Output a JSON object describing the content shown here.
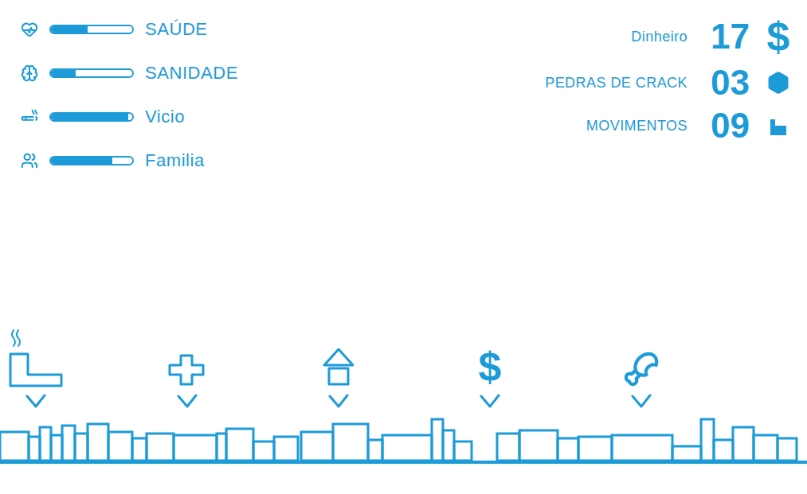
{
  "stats": [
    {
      "label": "SAÚDE",
      "kind": "health",
      "level": 0.45
    },
    {
      "label": "SANIDADE",
      "kind": "sanity",
      "level": 0.3
    },
    {
      "label": "Vicio",
      "kind": "addiction",
      "level": 0.95
    },
    {
      "label": "Familia",
      "kind": "family",
      "level": 0.75
    }
  ],
  "resources": [
    {
      "label": "Dinheiro",
      "value": "17",
      "symbol": "$",
      "kind": "money"
    },
    {
      "label": "PEDRAS DE CRACK",
      "value": "03",
      "kind": "crack"
    },
    {
      "label": "MOVIMENTOS",
      "value": "09",
      "kind": "moves"
    }
  ],
  "locations": [
    {
      "kind": "smoke",
      "checked": true
    },
    {
      "kind": "hospital",
      "checked": true
    },
    {
      "kind": "home",
      "checked": true
    },
    {
      "kind": "bank",
      "glyph": "$",
      "checked": true
    },
    {
      "kind": "food",
      "checked": true
    }
  ]
}
